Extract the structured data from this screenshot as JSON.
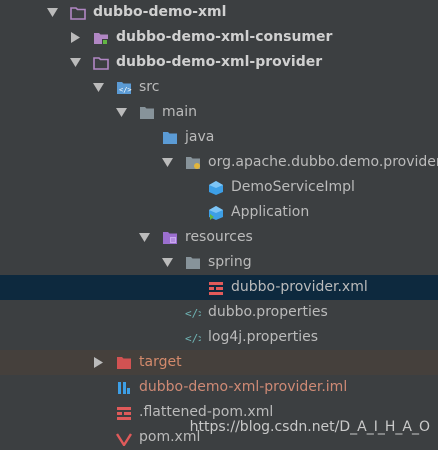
{
  "tree": {
    "items": [
      {
        "label": "dubbo-demo-xml",
        "expanded": true,
        "icon": "module-folder-icon"
      },
      {
        "label": "dubbo-demo-xml-consumer",
        "expanded": false,
        "icon": "module-folder-icon"
      },
      {
        "label": "dubbo-demo-xml-provider",
        "expanded": true,
        "icon": "module-folder-icon"
      },
      {
        "label": "src",
        "expanded": true,
        "icon": "source-folder-icon"
      },
      {
        "label": "main",
        "expanded": true,
        "icon": "folder-icon"
      },
      {
        "label": "java",
        "expanded": false,
        "icon": "source-root-folder-icon"
      },
      {
        "label": "org.apache.dubbo.demo.provider",
        "expanded": true,
        "icon": "package-icon"
      },
      {
        "label": "DemoServiceImpl",
        "icon": "class-icon"
      },
      {
        "label": "Application",
        "icon": "class-icon"
      },
      {
        "label": "resources",
        "expanded": true,
        "icon": "resources-folder-icon"
      },
      {
        "label": "spring",
        "expanded": true,
        "icon": "folder-icon"
      },
      {
        "label": "dubbo-provider.xml",
        "icon": "xml-file-icon",
        "selected": true
      },
      {
        "label": "dubbo.properties",
        "icon": "properties-file-icon"
      },
      {
        "label": "log4j.properties",
        "icon": "properties-file-icon"
      },
      {
        "label": "target",
        "expanded": false,
        "icon": "excluded-folder-icon"
      },
      {
        "label": "dubbo-demo-xml-provider.iml",
        "icon": "iml-file-icon"
      },
      {
        "label": ".flattened-pom.xml",
        "icon": "xml-file-icon"
      },
      {
        "label": "pom.xml",
        "icon": "maven-icon"
      }
    ]
  },
  "watermark": "https://blog.csdn.net/D_A_I_H_A_O",
  "colors": {
    "background": "#3c3f41",
    "selection": "#0d293e",
    "excluded_row": "#45403c",
    "folder": "#87939a",
    "module_folder": "#b187c4",
    "source_folder": "#5b9bd5",
    "class_icon": "#3d9fe6",
    "xml_icon": "#e05a5a",
    "target_label": "#d48a6c"
  }
}
